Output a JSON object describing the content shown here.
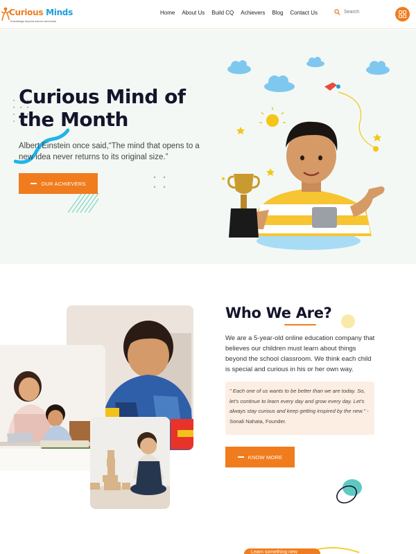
{
  "brand": {
    "name_part1": "Curious",
    "name_part2": "Minds",
    "tagline": "Knowledge beyond school curriculum",
    "orange": "#f07c1d",
    "blue": "#1e9fd8"
  },
  "nav": {
    "items": [
      "Home",
      "About Us",
      "Build CQ",
      "Achievers",
      "Blog",
      "Contact Us"
    ]
  },
  "search": {
    "placeholder": "Search",
    "icon": "search-icon"
  },
  "menu_icon": "grid-menu-icon",
  "hero": {
    "title": "Curious Mind of the Month",
    "quote": "Albert Einstein once said,“The mind that opens to a new idea never returns to its original size.”",
    "button_label": "OUR ACHIEVERS",
    "background": "#f3f8f4"
  },
  "who": {
    "title": "Who We Are?",
    "description": "We are a 5-year-old online education company that believes our children must learn about things beyond the school classroom. We think each child is special and curious in his or her own way.",
    "quote": "\" Each one of us wants to be better than we are today. So, let's continue to learn every day and grow every day. Let's always stay curious and keep getting inspired by the new.\"",
    "quote_author": " - Sonali Nahata, Founder.",
    "button_label": "KNOW MORE"
  },
  "bottom_banner": {
    "label": "Learn something new"
  }
}
